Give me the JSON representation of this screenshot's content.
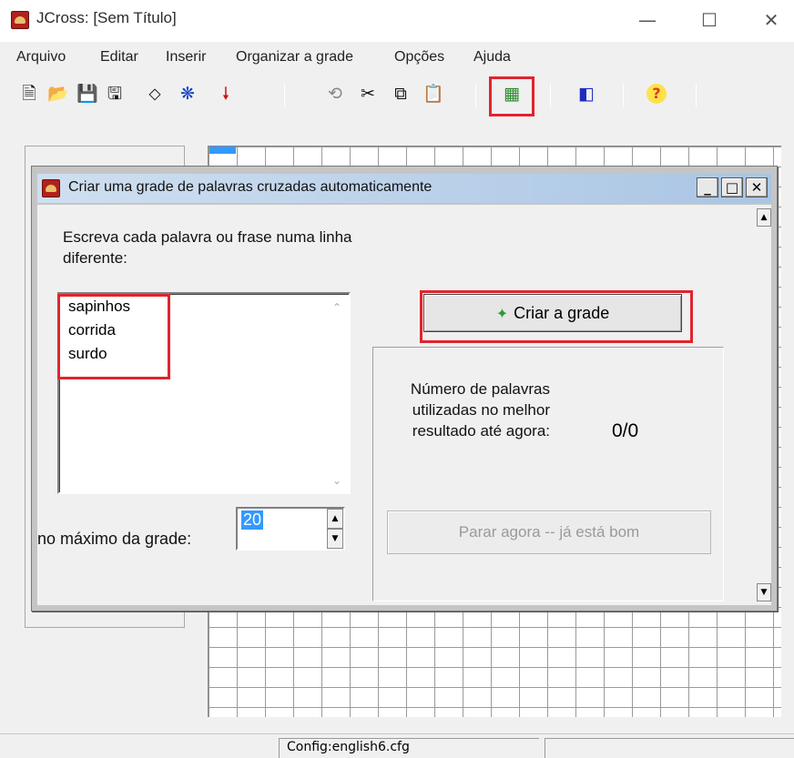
{
  "window": {
    "title": "JCross: [Sem Título]",
    "minimize_glyph": "—",
    "maximize_glyph": "☐",
    "close_glyph": "✕"
  },
  "menu": [
    "Arquivo",
    "Editar",
    "Inserir",
    "Organizar a grade",
    "Opções",
    "Ajuda"
  ],
  "toolbar": {
    "icons": [
      "new-icon",
      "open-icon",
      "save-icon",
      "save-as-icon",
      "eraser-icon",
      "web-export-icon",
      "red-arrow-icon",
      "undo-icon",
      "cut-icon",
      "copy-icon",
      "paste-icon",
      "auto-grid-icon",
      "settings-icon",
      "help-icon"
    ],
    "glyphs": {
      "new": "🗎",
      "open": "📂",
      "save": "💾",
      "save_as": "🖫",
      "eraser": "⬦",
      "web": "❋",
      "arrow": "🠗",
      "undo": "⟲",
      "cut": "✂",
      "copy": "⧉",
      "paste": "📋",
      "auto_grid": "▦",
      "settings": "◧",
      "help": "?"
    }
  },
  "status": {
    "config": "Config:english6.cfg"
  },
  "dialog": {
    "title": "Criar uma grade de palavras cruzadas automaticamente",
    "min_glyph": "_",
    "max_glyph": "□",
    "close_glyph": "✕",
    "instructions": "Escreva cada palavra ou frase numa linha diferente:",
    "words": [
      "sapinhos",
      "corrida",
      "surdo"
    ],
    "size_label": "no máximo da grade:",
    "size_value": "20",
    "create_button": "Criar a grade",
    "result_label": "Número de palavras utilizadas no melhor resultado até agora:",
    "result_value": "0/0",
    "stop_button": "Parar agora -- já está bom"
  },
  "colors": {
    "highlight": "#e0242e",
    "selection": "#3399ff"
  }
}
